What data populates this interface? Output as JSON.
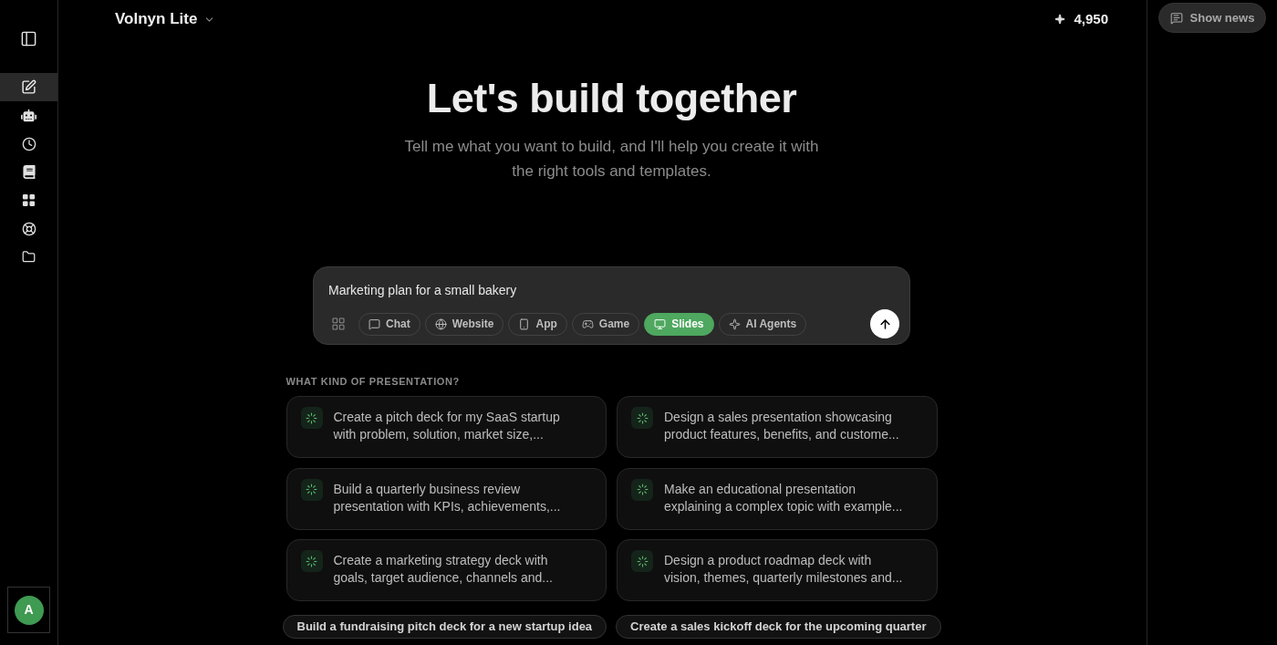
{
  "header": {
    "workspace": "Volnyn Lite",
    "credits": "4,950",
    "news_button": "Show news"
  },
  "sidebar": {
    "items": [
      {
        "selected": true
      },
      {
        "selected": false
      },
      {
        "selected": false
      },
      {
        "selected": false
      },
      {
        "selected": false
      },
      {
        "selected": false
      },
      {
        "selected": false
      }
    ],
    "avatar": "A"
  },
  "hero": {
    "title": "Let's build together",
    "subtitle": "Tell me what you want to build, and I'll help you create it with the right tools and templates."
  },
  "composer": {
    "value": "Marketing plan for a small bakery",
    "modes": [
      {
        "label": "Chat",
        "selected": false
      },
      {
        "label": "Website",
        "selected": false
      },
      {
        "label": "App",
        "selected": false
      },
      {
        "label": "Game",
        "selected": false
      },
      {
        "label": "Slides",
        "selected": true
      },
      {
        "label": "AI Agents",
        "selected": false
      }
    ]
  },
  "suggestions": {
    "heading": "WHAT KIND OF PRESENTATION?",
    "cards": [
      "Create a pitch deck for my SaaS startup with problem, solution, market size,...",
      "Design a sales presentation showcasing product features, benefits, and custome...",
      "Build a quarterly business review presentation with KPIs, achievements,...",
      "Make an educational presentation explaining a complex topic with example...",
      "Create a marketing strategy deck with goals, target audience, channels and...",
      "Design a product roadmap deck with vision, themes, quarterly milestones and..."
    ],
    "chips": [
      "Build a fundraising pitch deck for a new startup idea",
      "Create a sales kickoff deck for the upcoming quarter"
    ]
  }
}
